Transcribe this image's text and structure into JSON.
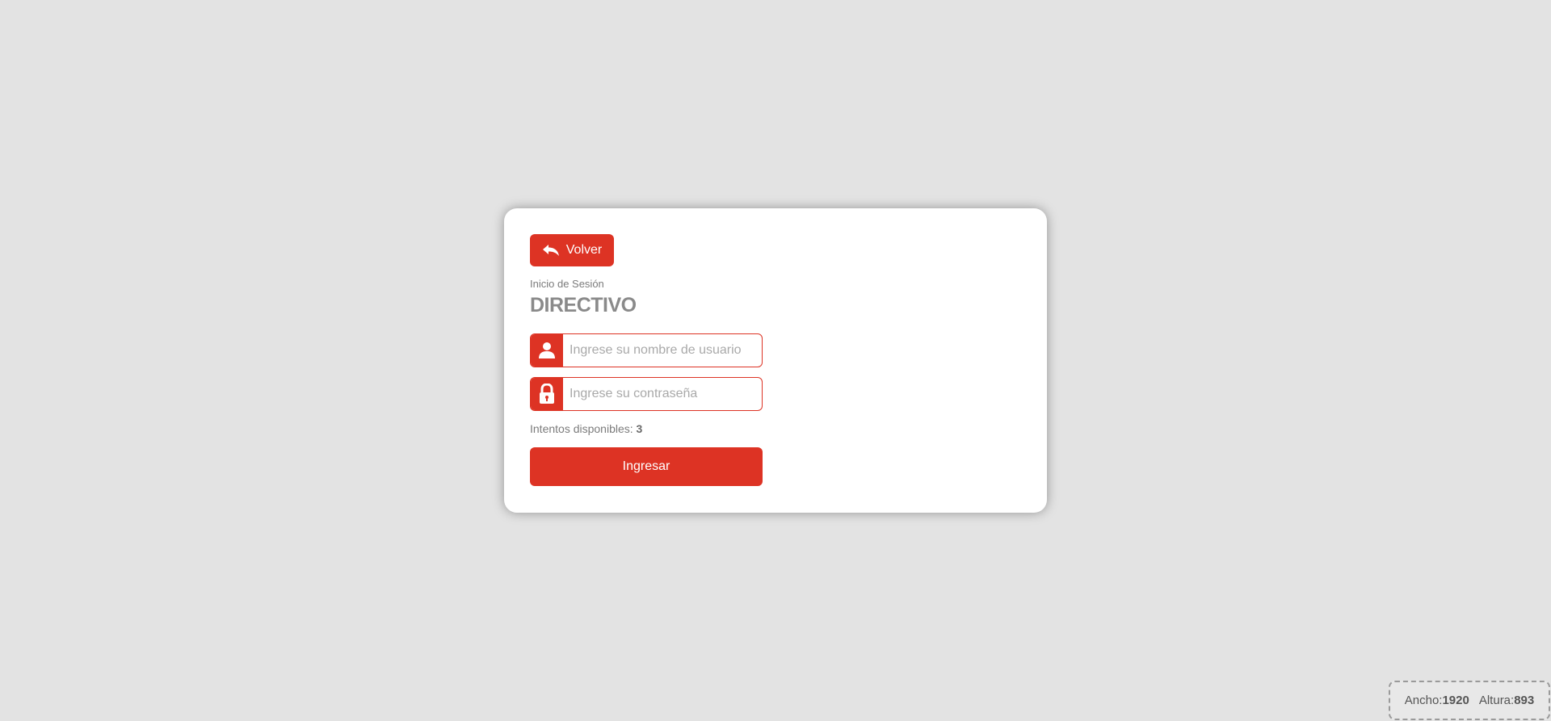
{
  "login": {
    "back_label": "Volver",
    "subtitle": "Inicio de Sesión",
    "title": "DIRECTIVO",
    "username_placeholder": "Ingrese su nombre de usuario",
    "password_placeholder": "Ingrese su contraseña",
    "attempts_label": "Intentos disponibles:",
    "attempts_value": "3",
    "submit_label": "Ingresar",
    "icons": {
      "back": "reply-arrow-icon",
      "username": "user-icon",
      "password": "lock-icon"
    }
  },
  "viewport_badge": {
    "width_label": "Ancho:",
    "width_value": "1920",
    "height_label": "Altura:",
    "height_value": "893"
  },
  "colors": {
    "accent": "#dd3324",
    "background": "#e3e3e3",
    "card": "#ffffff"
  }
}
